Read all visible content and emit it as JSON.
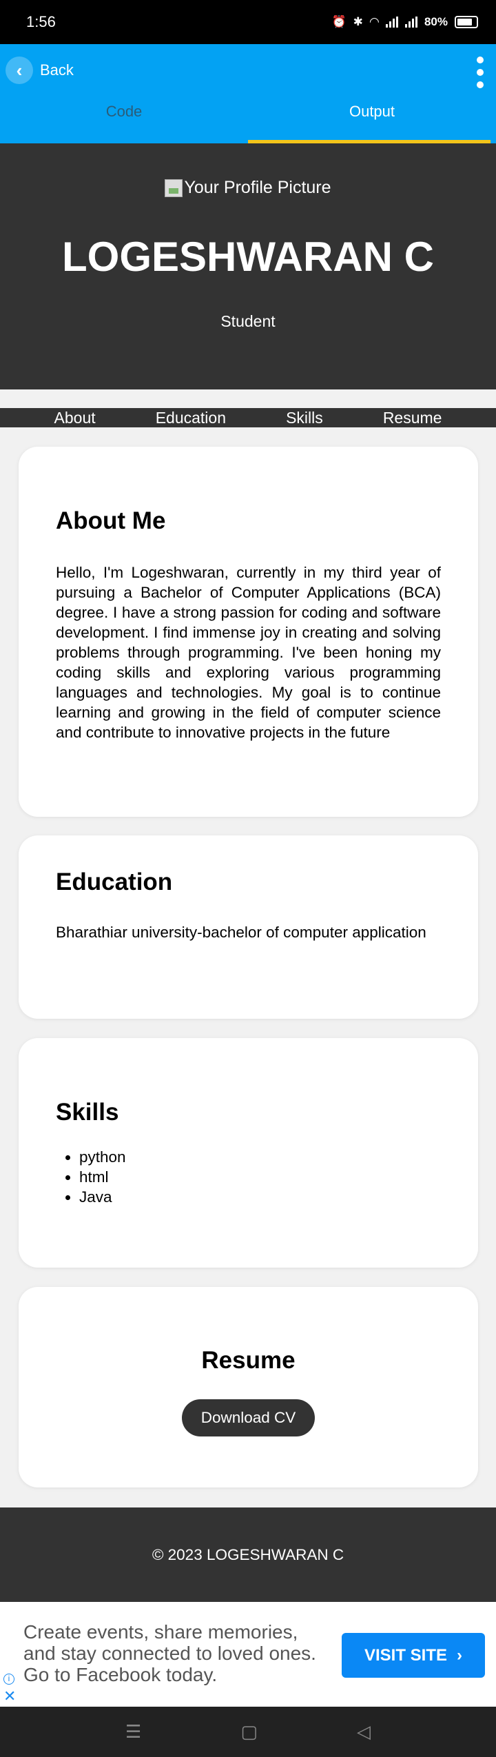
{
  "status_bar": {
    "time": "1:56",
    "battery": "80%"
  },
  "app_bar": {
    "back_label": "Back",
    "tabs": [
      {
        "label": "Code"
      },
      {
        "label": "Output"
      }
    ]
  },
  "header": {
    "profile_alt": "Your Profile Picture",
    "name": "LOGESHWARAN C",
    "role": "Student"
  },
  "nav": {
    "items": [
      "About",
      "Education",
      "Skills",
      "Resume"
    ]
  },
  "about": {
    "title": "About Me",
    "text": "Hello, I'm Logeshwaran, currently in my third year of pursuing a Bachelor of Computer Applications (BCA) degree. I have a strong passion for coding and software development. I find immense joy in creating and solving problems through programming. I've been honing my coding skills and exploring various programming languages and technologies. My goal is to continue learning and growing in the field of computer science and contribute to innovative projects in the future"
  },
  "education": {
    "title": "Education",
    "text": "Bharathiar university-bachelor of computer application"
  },
  "skills": {
    "title": "Skills",
    "items": [
      "python",
      "html",
      "Java"
    ]
  },
  "resume": {
    "title": "Resume",
    "button_label": "Download CV"
  },
  "footer": {
    "text": "© 2023 LOGESHWARAN C"
  },
  "ad": {
    "text": "Create events, share memories, and stay connected to loved ones. Go to Facebook today.",
    "button_label": "VISIT SITE",
    "brand_color": "#0a88f5"
  },
  "colors": {
    "app_bar": "#03a2f3",
    "tab_indicator": "#f3c51a",
    "dark": "#333333"
  }
}
